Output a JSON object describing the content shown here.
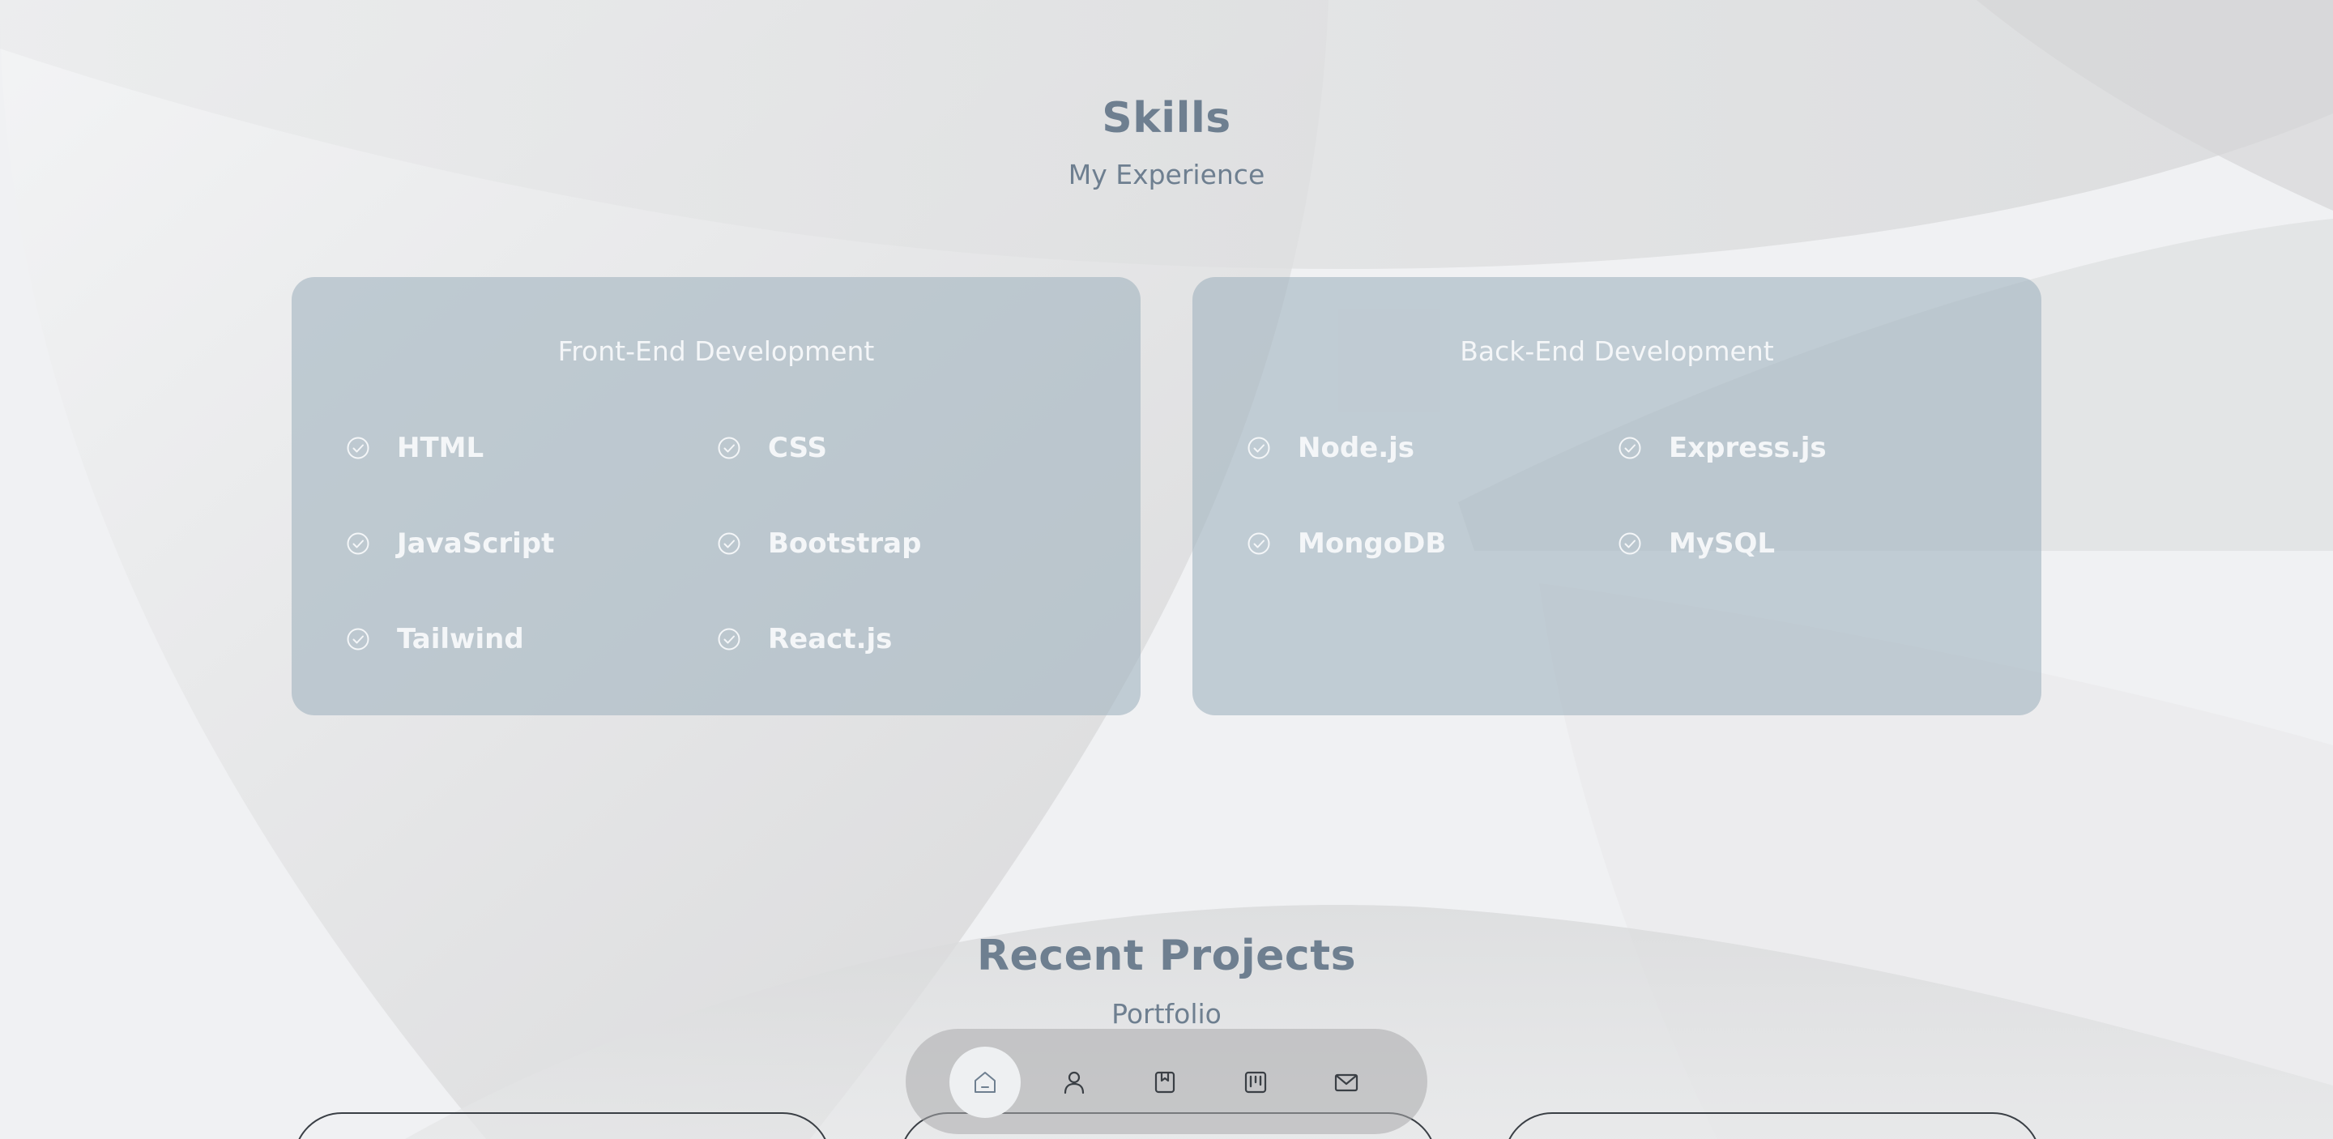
{
  "skills": {
    "title": "Skills",
    "subtitle": "My Experience",
    "cards": [
      {
        "title": "Front-End Development",
        "items": [
          {
            "label": "HTML",
            "icon": "check-circle-icon"
          },
          {
            "label": "CSS",
            "icon": "check-circle-icon"
          },
          {
            "label": "JavaScript",
            "icon": "check-circle-icon"
          },
          {
            "label": "Bootstrap",
            "icon": "check-circle-icon"
          },
          {
            "label": "Tailwind",
            "icon": "check-circle-icon"
          },
          {
            "label": "React.js",
            "icon": "check-circle-icon"
          }
        ]
      },
      {
        "title": "Back-End Development",
        "items": [
          {
            "label": "Node.js",
            "icon": "check-circle-icon"
          },
          {
            "label": "Express.js",
            "icon": "check-circle-icon"
          },
          {
            "label": "MongoDB",
            "icon": "check-circle-icon"
          },
          {
            "label": "MySQL",
            "icon": "check-circle-icon"
          }
        ]
      }
    ]
  },
  "projects": {
    "title": "Recent Projects",
    "subtitle": "Portfolio"
  },
  "dock": {
    "items": [
      {
        "icon": "home-icon",
        "active": true
      },
      {
        "icon": "user-icon",
        "active": false
      },
      {
        "icon": "bookmark-icon",
        "active": false
      },
      {
        "icon": "kanban-icon",
        "active": false
      },
      {
        "icon": "mail-icon",
        "active": false
      }
    ]
  },
  "colors": {
    "heading": "#6e7f90",
    "card_bg": "#a3b4c0",
    "card_text": "#f4f6f8",
    "page_bg": "#eef0f2"
  }
}
